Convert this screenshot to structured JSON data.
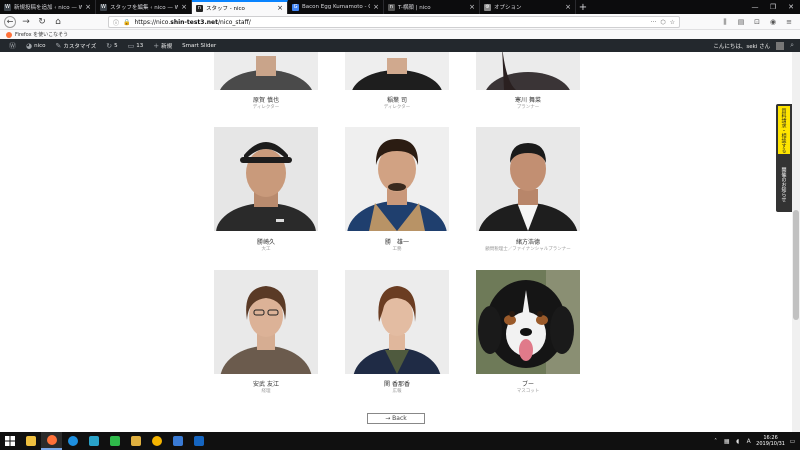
{
  "browser": {
    "tabs": [
      {
        "title": "新規投稿を追加 ‹ nico — Word…",
        "fav_color": "#3c434a",
        "active": false
      },
      {
        "title": "スタッフを編集 ‹ nico — WordPress…",
        "fav_color": "#3c434a",
        "active": false
      },
      {
        "title": "スタッフ - nico",
        "fav_color": "#222222",
        "active": true
      },
      {
        "title": "Bacon Egg Kumamoto - Google…",
        "fav_color": "#4285f4",
        "active": false
      },
      {
        "title": "T-横顔 | nico",
        "fav_color": "#555555",
        "active": false
      },
      {
        "title": "オプション",
        "fav_color": "#888888",
        "active": false
      }
    ],
    "url_prefix": "https://nico.",
    "url_domain": "shin-test3.net",
    "url_path": "/nico_staff/",
    "more_label": "···",
    "bookmark_label": "Firefox を使いこなそう"
  },
  "wp_admin": {
    "site_name": "nico",
    "customize": "カスタマイズ",
    "updates_count": "5",
    "comments_count": "13",
    "new_label": "新規",
    "slider_label": "Smart Slider",
    "greeting": "こんにちは、seki さん"
  },
  "staff": [
    {
      "name": "原賀 慎也",
      "role": "ディレクター"
    },
    {
      "name": "稲葉 司",
      "role": "ディレクター"
    },
    {
      "name": "寒川 舞菜",
      "role": "プランナー"
    },
    {
      "name": "勝崎久",
      "role": "大工"
    },
    {
      "name": "勝　雄一",
      "role": "工務"
    },
    {
      "name": "緒方浩德",
      "role": "顧問税理士／ファイナンシャルプランナー"
    },
    {
      "name": "安武 友江",
      "role": "経理"
    },
    {
      "name": "関 香那香",
      "role": "広報"
    },
    {
      "name": "ブー",
      "role": "マスコット"
    }
  ],
  "back_label": "→ Back",
  "side_tab": {
    "primary": "資料請求・相談する",
    "secondary": "開催のお知らせ"
  },
  "taskbar": {
    "time": "16:26",
    "date": "2019/10/31"
  },
  "colors": {
    "tab_active_accent": "#0a84ff",
    "wp_bar": "#23282d",
    "side_tab_yellow": "#ffe500",
    "taskbar": "#101010"
  }
}
